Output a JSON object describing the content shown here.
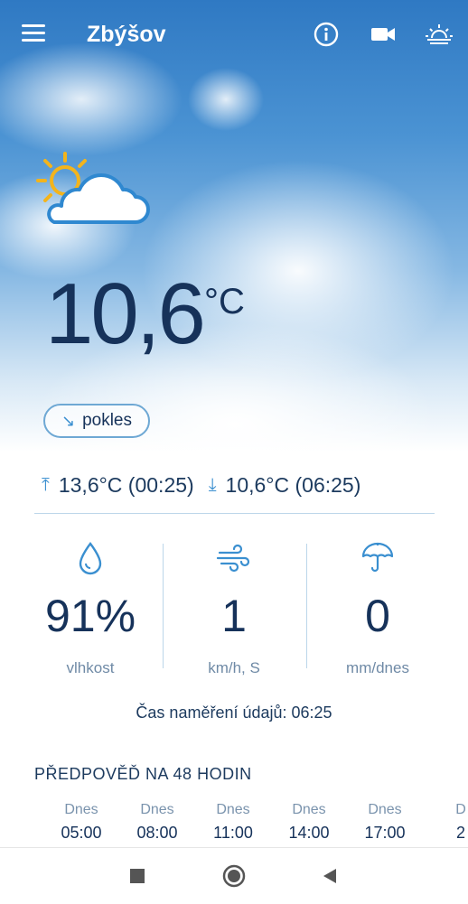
{
  "header": {
    "city": "Zbýšov",
    "icons": [
      "menu-icon",
      "info-icon",
      "video-camera-icon",
      "sunrise-icon"
    ]
  },
  "current": {
    "condition_icon": "partly-cloudy-icon",
    "temperature": "10,6",
    "unit": "°C",
    "trend_label": "pokles",
    "trend_icon": "arrow-down-right-icon",
    "max": "13,6°C (00:25)",
    "min": "10,6°C (06:25)"
  },
  "stats": {
    "humidity": {
      "value": "91%",
      "label": "vlhkost",
      "icon": "water-drop-icon"
    },
    "wind": {
      "value": "1",
      "label": "km/h, S",
      "icon": "wind-icon"
    },
    "rain": {
      "value": "0",
      "label": "mm/dnes",
      "icon": "umbrella-icon"
    }
  },
  "measured_time": "Čas naměření údajů: 06:25",
  "forecast": {
    "title": "PŘEDPOVĚĎ NA 48 HODIN",
    "columns": [
      {
        "day": "Dnes",
        "time": "05:00"
      },
      {
        "day": "Dnes",
        "time": "08:00"
      },
      {
        "day": "Dnes",
        "time": "11:00"
      },
      {
        "day": "Dnes",
        "time": "14:00"
      },
      {
        "day": "Dnes",
        "time": "17:00"
      },
      {
        "day": "D",
        "time": "2"
      }
    ]
  },
  "colors": {
    "accent": "#3a8fd0",
    "text_dark": "#16325a",
    "sky_top": "#2f79c3"
  }
}
